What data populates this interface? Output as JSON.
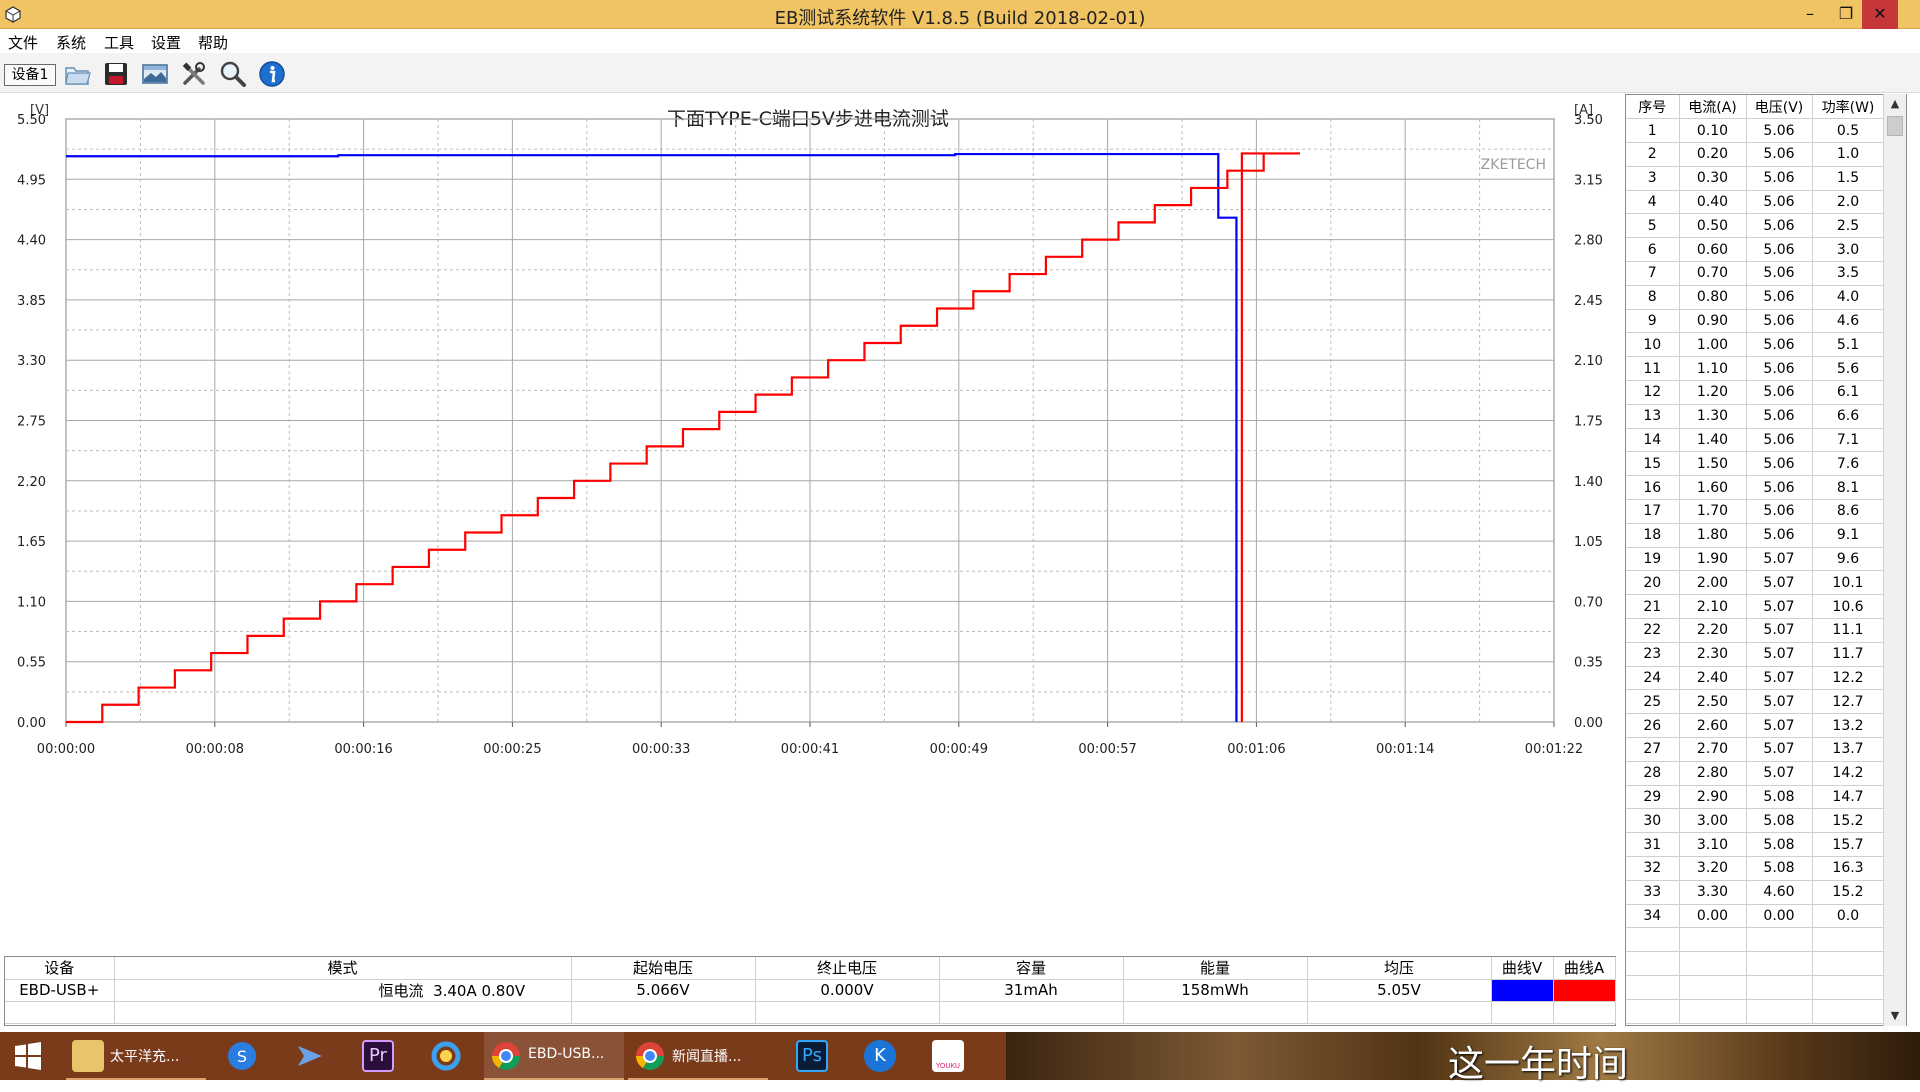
{
  "window": {
    "title": "EB测试系统软件 V1.8.5 (Build 2018-02-01)",
    "minimize_glyph": "–",
    "maximize_glyph": "❐",
    "close_glyph": "✕"
  },
  "menu": {
    "items": [
      "文件",
      "系统",
      "工具",
      "设置",
      "帮助"
    ]
  },
  "toolbar": {
    "device_tab": "设备1",
    "icons": [
      "open-folder-icon",
      "save-disk-icon",
      "picture-icon",
      "tools-icon",
      "magnifier-icon",
      "info-icon"
    ]
  },
  "chart_data": {
    "type": "line",
    "title": "下面TYPE-C端口5V步进电流测试",
    "left_axis_unit": "[V]",
    "right_axis_unit": "[A]",
    "watermark": "ZKETECH",
    "x_ticks": [
      "00:00:00",
      "00:00:08",
      "00:00:16",
      "00:00:25",
      "00:00:33",
      "00:00:41",
      "00:00:49",
      "00:00:57",
      "00:01:06",
      "00:01:14",
      "00:01:22"
    ],
    "x_range_seconds": [
      0,
      82
    ],
    "left_ticks": [
      "5.50",
      "4.95",
      "4.40",
      "3.85",
      "3.30",
      "2.75",
      "2.20",
      "1.65",
      "1.10",
      "0.55",
      "0.00"
    ],
    "right_ticks": [
      "3.50",
      "3.15",
      "2.80",
      "2.45",
      "2.10",
      "1.75",
      "1.40",
      "1.05",
      "0.70",
      "0.35",
      "0.00"
    ],
    "y_left_range": [
      0,
      5.5
    ],
    "y_right_range": [
      0,
      3.5
    ],
    "grid": true,
    "series": [
      {
        "name": "曲线V",
        "axis": "left",
        "color": "#0000ff",
        "points": [
          [
            0,
            5.16
          ],
          [
            15,
            5.16
          ],
          [
            15,
            5.17
          ],
          [
            49,
            5.17
          ],
          [
            49,
            5.18
          ],
          [
            63.5,
            5.18
          ],
          [
            63.5,
            4.6
          ],
          [
            64.5,
            4.6
          ],
          [
            64.5,
            0.0
          ]
        ]
      },
      {
        "name": "曲线A",
        "axis": "right",
        "color": "#ff0000",
        "step_seconds": 2,
        "step_values": [
          0.0,
          0.1,
          0.2,
          0.3,
          0.4,
          0.5,
          0.6,
          0.7,
          0.8,
          0.9,
          1.0,
          1.1,
          1.2,
          1.3,
          1.4,
          1.5,
          1.6,
          1.7,
          1.8,
          1.9,
          2.0,
          2.1,
          2.2,
          2.3,
          2.4,
          2.5,
          2.6,
          2.7,
          2.8,
          2.9,
          3.0,
          3.1,
          3.2,
          3.3,
          0.0
        ],
        "end_seconds": 64.8
      }
    ]
  },
  "table": {
    "headers": [
      "序号",
      "电流(A)",
      "电压(V)",
      "功率(W)"
    ],
    "rows": [
      [
        "1",
        "0.10",
        "5.06",
        "0.5"
      ],
      [
        "2",
        "0.20",
        "5.06",
        "1.0"
      ],
      [
        "3",
        "0.30",
        "5.06",
        "1.5"
      ],
      [
        "4",
        "0.40",
        "5.06",
        "2.0"
      ],
      [
        "5",
        "0.50",
        "5.06",
        "2.5"
      ],
      [
        "6",
        "0.60",
        "5.06",
        "3.0"
      ],
      [
        "7",
        "0.70",
        "5.06",
        "3.5"
      ],
      [
        "8",
        "0.80",
        "5.06",
        "4.0"
      ],
      [
        "9",
        "0.90",
        "5.06",
        "4.6"
      ],
      [
        "10",
        "1.00",
        "5.06",
        "5.1"
      ],
      [
        "11",
        "1.10",
        "5.06",
        "5.6"
      ],
      [
        "12",
        "1.20",
        "5.06",
        "6.1"
      ],
      [
        "13",
        "1.30",
        "5.06",
        "6.6"
      ],
      [
        "14",
        "1.40",
        "5.06",
        "7.1"
      ],
      [
        "15",
        "1.50",
        "5.06",
        "7.6"
      ],
      [
        "16",
        "1.60",
        "5.06",
        "8.1"
      ],
      [
        "17",
        "1.70",
        "5.06",
        "8.6"
      ],
      [
        "18",
        "1.80",
        "5.06",
        "9.1"
      ],
      [
        "19",
        "1.90",
        "5.07",
        "9.6"
      ],
      [
        "20",
        "2.00",
        "5.07",
        "10.1"
      ],
      [
        "21",
        "2.10",
        "5.07",
        "10.6"
      ],
      [
        "22",
        "2.20",
        "5.07",
        "11.1"
      ],
      [
        "23",
        "2.30",
        "5.07",
        "11.7"
      ],
      [
        "24",
        "2.40",
        "5.07",
        "12.2"
      ],
      [
        "25",
        "2.50",
        "5.07",
        "12.7"
      ],
      [
        "26",
        "2.60",
        "5.07",
        "13.2"
      ],
      [
        "27",
        "2.70",
        "5.07",
        "13.7"
      ],
      [
        "28",
        "2.80",
        "5.07",
        "14.2"
      ],
      [
        "29",
        "2.90",
        "5.08",
        "14.7"
      ],
      [
        "30",
        "3.00",
        "5.08",
        "15.2"
      ],
      [
        "31",
        "3.10",
        "5.08",
        "15.7"
      ],
      [
        "32",
        "3.20",
        "5.08",
        "16.3"
      ],
      [
        "33",
        "3.30",
        "4.60",
        "15.2"
      ],
      [
        "34",
        "0.00",
        "0.00",
        "0.0"
      ]
    ],
    "empty_rows": 4
  },
  "summary": {
    "headers": [
      "设备",
      "模式",
      "起始电压",
      "终止电压",
      "容量",
      "能量",
      "均压",
      "曲线V",
      "曲线A"
    ],
    "device": "EBD-USB+",
    "mode_name": "恒电流",
    "mode_params": "3.40A  0.80V",
    "start_voltage": "5.066V",
    "end_voltage": "0.000V",
    "capacity": "31mAh",
    "energy": "158mWh",
    "avg_voltage": "5.05V",
    "curve_v_color": "#0000ff",
    "curve_a_color": "#ff0000"
  },
  "taskbar": {
    "items": [
      {
        "name": "windows-start-icon",
        "label": ""
      },
      {
        "name": "folder-app-icon",
        "label": "太平洋充..."
      },
      {
        "name": "sogou-icon",
        "label": ""
      },
      {
        "name": "feishu-icon",
        "label": ""
      },
      {
        "name": "premiere-icon",
        "label": "Pr"
      },
      {
        "name": "qq-browser-icon",
        "label": ""
      },
      {
        "name": "chrome-icon",
        "label": "EBD-USB..."
      },
      {
        "name": "chrome-icon",
        "label": "新闻直播..."
      },
      {
        "name": "photoshop-icon",
        "label": "Ps"
      },
      {
        "name": "kugou-icon",
        "label": "K"
      },
      {
        "name": "youku-icon",
        "label": "YOUKU"
      }
    ],
    "subtitle": "这一年时间"
  }
}
